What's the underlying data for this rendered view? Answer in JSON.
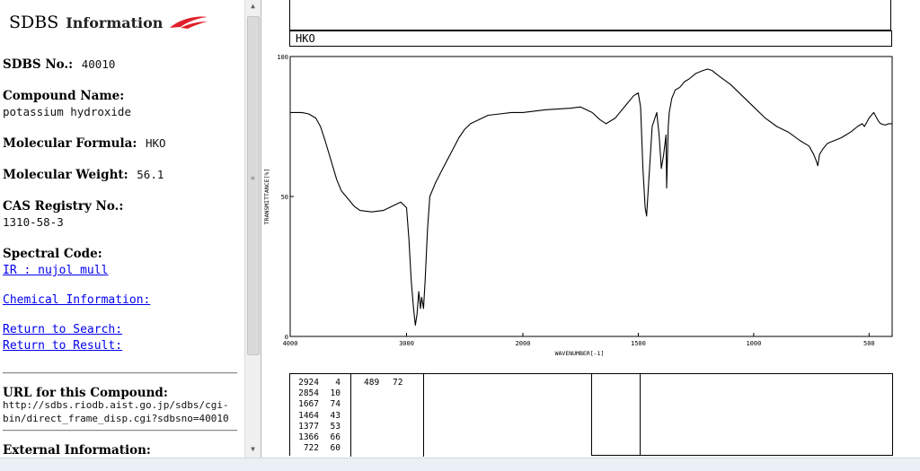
{
  "info": {
    "title_main": "SDBS",
    "title_sub": "Information",
    "sdbs_no_label": "SDBS No.:",
    "sdbs_no": "40010",
    "compound_name_label": "Compound Name:",
    "compound_name": "potassium hydroxide",
    "formula_label": "Molecular Formula:",
    "formula": "HKO",
    "weight_label": "Molecular Weight:",
    "weight": "56.1",
    "cas_label": "CAS Registry No.:",
    "cas": "1310-58-3",
    "spectral_code_label": "Spectral Code:",
    "spectral_code_link": "IR : nujol mull",
    "chem_info_link": "Chemical Information:",
    "return_search_link": "Return to Search:",
    "return_result_link": "Return to Result:",
    "url_label": "URL for this Compound:",
    "url_line1": "http://sdbs.riodb.aist.go.jp/sdbs/cgi-",
    "url_line2": "bin/direct_frame_disp.cgi?sdbsno=40010",
    "external_label": "External Information:"
  },
  "spectrum_header": "HKO",
  "colors": {
    "link": "#0000ee",
    "logo_red": "#e0202a",
    "ink": "#000000"
  },
  "chart_data": {
    "type": "line",
    "title": "",
    "xlabel": "WAVENUMBER[-1]",
    "ylabel": "TRANSMITTANCE[%]",
    "xlim": [
      4000,
      400
    ],
    "ylim": [
      0,
      100
    ],
    "x_ticks": [
      4000,
      3000,
      2000,
      1500,
      1000,
      500
    ],
    "y_ticks": [
      0,
      50,
      100
    ],
    "grid": false,
    "series": [
      {
        "x": [
          4000,
          3900,
          3840,
          3780,
          3740,
          3700,
          3650,
          3600,
          3560,
          3500,
          3450,
          3400,
          3300,
          3200,
          3100,
          3050,
          3000,
          2980,
          2960,
          2940,
          2924,
          2910,
          2895,
          2880,
          2870,
          2854,
          2840,
          2820,
          2800,
          2750,
          2700,
          2650,
          2600,
          2550,
          2500,
          2450,
          2400,
          2300,
          2200,
          2100,
          2000,
          1900,
          1800,
          1750,
          1700,
          1667,
          1640,
          1600,
          1550,
          1520,
          1500,
          1490,
          1480,
          1470,
          1464,
          1455,
          1440,
          1420,
          1410,
          1400,
          1390,
          1380,
          1377,
          1370,
          1366,
          1355,
          1340,
          1320,
          1300,
          1280,
          1250,
          1220,
          1200,
          1180,
          1150,
          1100,
          1050,
          1000,
          950,
          900,
          850,
          800,
          760,
          740,
          730,
          722,
          715,
          700,
          680,
          650,
          620,
          600,
          580,
          550,
          530,
          520,
          500,
          480,
          460,
          450,
          430,
          415,
          400
        ],
        "y": [
          80,
          80,
          79.5,
          78,
          75,
          70,
          63,
          56,
          52,
          49,
          46.5,
          45,
          44.5,
          45,
          47,
          48,
          46,
          35,
          20,
          10,
          4,
          8,
          16,
          10,
          14,
          10,
          20,
          38,
          50,
          55,
          59,
          63,
          67,
          71,
          74,
          76,
          77,
          79,
          79.5,
          80,
          80,
          81,
          81.5,
          82,
          80,
          77.5,
          76,
          78,
          83,
          86,
          87,
          82,
          60,
          46,
          43,
          55,
          75,
          80,
          72,
          60,
          65,
          72,
          53,
          75,
          80,
          85,
          88,
          89,
          91,
          92,
          94,
          95,
          95.5,
          95,
          93,
          90,
          86,
          82,
          78,
          75,
          73,
          70,
          68,
          65,
          63,
          61,
          65,
          67,
          69,
          70,
          71,
          72,
          73,
          75,
          76,
          75,
          78,
          80,
          77,
          76,
          75.5,
          76,
          76
        ]
      }
    ]
  },
  "peaks": {
    "rows": [
      {
        "wn": "2924",
        "t": "4"
      },
      {
        "wn": "2854",
        "t": "10"
      },
      {
        "wn": "1667",
        "t": "74"
      },
      {
        "wn": "1464",
        "t": "43"
      },
      {
        "wn": "1377",
        "t": "53"
      },
      {
        "wn": "1366",
        "t": "66"
      },
      {
        "wn": "722",
        "t": "60"
      }
    ],
    "col2": {
      "wn": "489",
      "t": "72"
    }
  }
}
